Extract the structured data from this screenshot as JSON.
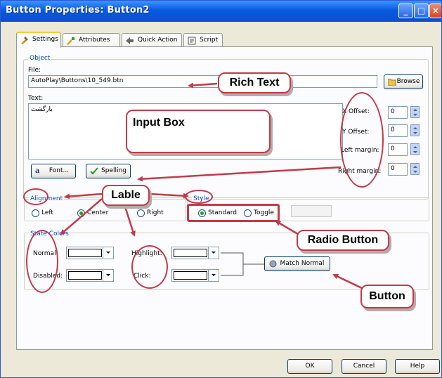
{
  "window": {
    "title": "Button Properties: Button2",
    "minimize_icon": "minimize-icon",
    "maximize_icon": "maximize-icon",
    "close_icon": "close-icon",
    "accent": "#0a5ae0"
  },
  "tabs": [
    {
      "label": "Settings",
      "icon": "settings-icon",
      "active": true
    },
    {
      "label": "Attributes",
      "icon": "attributes-icon"
    },
    {
      "label": "Quick Action",
      "icon": "quick-action-icon"
    },
    {
      "label": "Script",
      "icon": "script-icon"
    }
  ],
  "object": {
    "group_label": "Object",
    "file_label": "File:",
    "file_value": "AutoPlay\\Buttons\\10_549.btn",
    "browse_label": "Browse",
    "text_label": "Text:",
    "text_value": "بازگشت",
    "x_offset_label": "X Offset:",
    "x_offset_value": "0",
    "y_offset_label": "Y Offset:",
    "y_offset_value": "0",
    "left_margin_label": "Left margin:",
    "left_margin_value": "0",
    "right_margin_label": "Right margin:",
    "right_margin_value": "0",
    "font_button": "Font...",
    "spelling_button": "Spelling"
  },
  "alignment": {
    "label": "Alignment",
    "left": "Left",
    "center": "Center",
    "right": "Right",
    "selected": "Center"
  },
  "style": {
    "label": "Style",
    "standard": "Standard",
    "toggle": "Toggle",
    "selected": "Standard"
  },
  "state_colors": {
    "label": "State Colors",
    "normal": "Normal:",
    "highlight": "Highlight:",
    "disabled": "Disabled:",
    "click": "Click:",
    "match_button": "Match Normal"
  },
  "footer": {
    "ok": "OK",
    "cancel": "Cancel",
    "help": "Help"
  },
  "annotations": {
    "rich_text": "Rich Text",
    "input_box": "Input Box",
    "lable": "Lable",
    "radio_button": "Radio Button",
    "button": "Button",
    "color": "#c23a4a"
  }
}
